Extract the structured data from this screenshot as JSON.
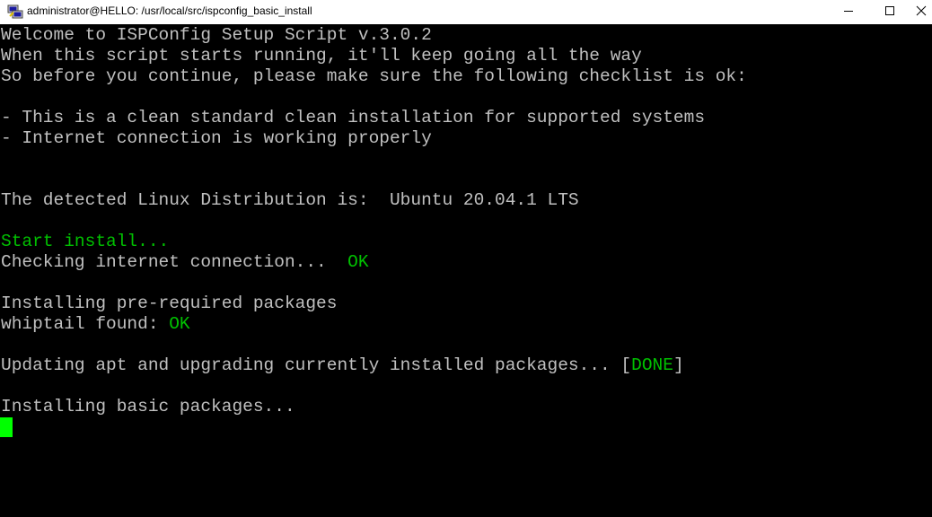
{
  "window": {
    "title": "administrator@HELLO: /usr/local/src/ispconfig_basic_install",
    "icon": "putty-icon",
    "controls": [
      "minimize-icon",
      "maximize-icon",
      "close-icon"
    ]
  },
  "colors": {
    "background": "#000000",
    "text": "#c0c0c0",
    "green": "#00c000",
    "cursor": "#00ff00"
  },
  "terminal": {
    "lines": {
      "l1": "Welcome to ISPConfig Setup Script v.3.0.2",
      "l2": "When this script starts running, it'll keep going all the way",
      "l3": "So before you continue, please make sure the following checklist is ok:",
      "l4": "- This is a clean standard clean installation for supported systems",
      "l5": "- Internet connection is working properly",
      "l6": "The detected Linux Distribution is:  Ubuntu 20.04.1 LTS",
      "l7": "Start install...",
      "l8a": "Checking internet connection...  ",
      "l8b": "OK",
      "l9": "Installing pre-required packages",
      "l10a": "whiptail found: ",
      "l10b": "OK",
      "l11a": "Updating apt and upgrading currently installed packages... [",
      "l11b": "DONE",
      "l11c": "]",
      "l12": "Installing basic packages..."
    }
  }
}
